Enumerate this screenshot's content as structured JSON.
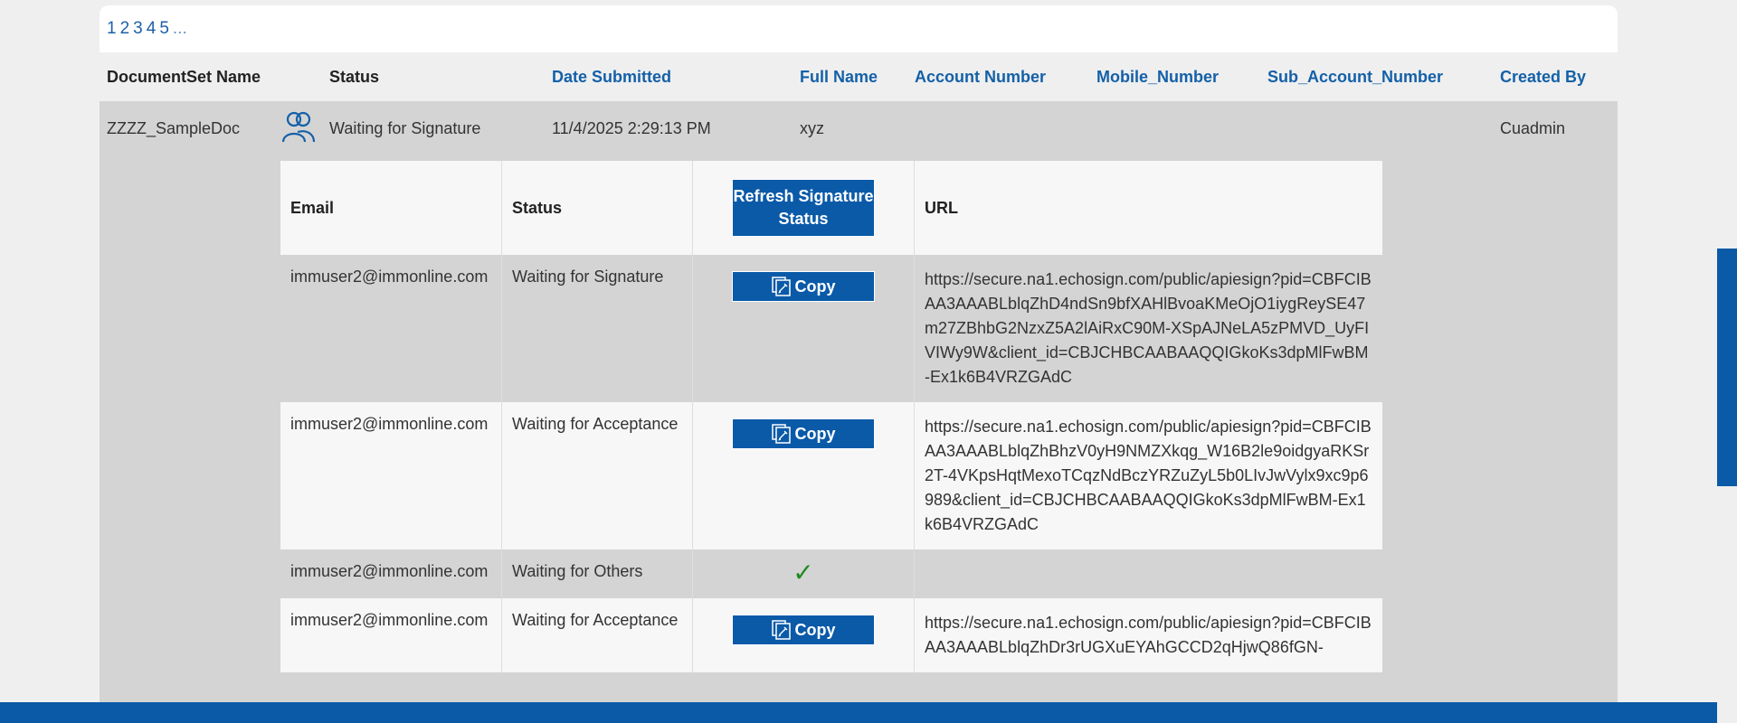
{
  "pager": {
    "pages": [
      "1",
      "2",
      "3",
      "4",
      "5"
    ],
    "more": "..."
  },
  "header": {
    "documentset_name": "DocumentSet Name",
    "status": "Status",
    "date_submitted": "Date Submitted",
    "full_name": "Full Name",
    "account_number": "Account Number",
    "mobile_number": "Mobile_Number",
    "sub_account_number": "Sub_Account_Number",
    "created_by": "Created By"
  },
  "row": {
    "documentset_name": "ZZZZ_SampleDoc",
    "status_icon": "people-icon",
    "status": "Waiting for Signature",
    "date_submitted": "11/4/2025 2:29:13 PM",
    "full_name": "xyz",
    "account_number": "",
    "mobile_number": "",
    "sub_account_number": "",
    "created_by": "Cuadmin"
  },
  "signers": {
    "headers": {
      "email": "Email",
      "status": "Status",
      "refresh_button": "Refresh Signature Status",
      "url": "URL"
    },
    "copy_label": "Copy",
    "copy_icon": "copy-icon",
    "rows": [
      {
        "email": "immuser2@immonline.com",
        "status": "Waiting for Signature",
        "action": "copy",
        "url": "https://secure.na1.echosign.com/public/apiesign?pid=CBFCIBAA3AAABLblqZhD4ndSn9bfXAHlBvoaKMeOjO1iygReySE47m27ZBhbG2NzxZ5A2lAiRxC90M-XSpAJNeLA5zPMVD_UyFIVIWy9W&client_id=CBJCHBCAABAAQQIGkoKs3dpMlFwBM-Ex1k6B4VRZGAdC"
      },
      {
        "email": "immuser2@immonline.com",
        "status": "Waiting for Acceptance",
        "action": "copy",
        "url": "https://secure.na1.echosign.com/public/apiesign?pid=CBFCIBAA3AAABLblqZhBhzV0yH9NMZXkqg_W16B2le9oidgyaRKSr2T-4VKpsHqtMexoTCqzNdBczYRZuZyL5b0LIvJwVylx9xc9p6989&client_id=CBJCHBCAABAAQQIGkoKs3dpMlFwBM-Ex1k6B4VRZGAdC"
      },
      {
        "email": "immuser2@immonline.com",
        "status": "Waiting for Others",
        "action": "check",
        "url": ""
      },
      {
        "email": "immuser2@immonline.com",
        "status": "Waiting for Acceptance",
        "action": "copy",
        "url": "https://secure.na1.echosign.com/public/apiesign?pid=CBFCIBAA3AAABLblqZhDr3rUGXuEYAhGCCD2qHjwQ86fGN-"
      }
    ]
  },
  "colors": {
    "accent": "#0a5aa8",
    "link": "#1460a8",
    "check": "#1f8a1f"
  }
}
